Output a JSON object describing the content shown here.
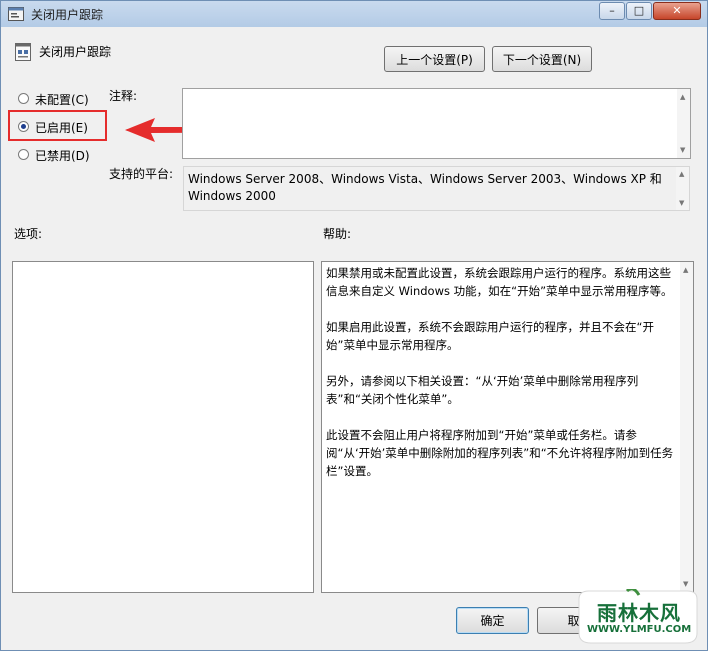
{
  "window": {
    "title": "关闭用户跟踪",
    "controls": {
      "minimize": "–",
      "maximize": "□",
      "close": "✕"
    }
  },
  "header": {
    "policy_name": "关闭用户跟踪",
    "prev_button": "上一个设置(P)",
    "next_button": "下一个设置(N)"
  },
  "options": {
    "not_configured": "未配置(C)",
    "enabled": "已启用(E)",
    "disabled": "已禁用(D)",
    "selected": "enabled"
  },
  "comment": {
    "label": "注释:",
    "value": ""
  },
  "platform": {
    "label": "支持的平台:",
    "value": "Windows Server 2008、Windows Vista、Windows Server 2003、Windows XP 和 Windows 2000"
  },
  "sections": {
    "options_label": "选项:",
    "help_label": "帮助:"
  },
  "help": {
    "paragraphs": [
      "如果禁用或未配置此设置，系统会跟踪用户运行的程序。系统用这些信息来自定义 Windows 功能，如在“开始”菜单中显示常用程序等。",
      "如果启用此设置，系统不会跟踪用户运行的程序，并且不会在“开始”菜单中显示常用程序。",
      "另外，请参阅以下相关设置：“从‘开始’菜单中删除常用程序列表”和“关闭个性化菜单”。",
      "此设置不会阻止用户将程序附加到“开始”菜单或任务栏。请参阅“从‘开始’菜单中删除附加的程序列表”和“不允许将程序附加到任务栏”设置。"
    ]
  },
  "footer": {
    "ok": "确定",
    "cancel": "取"
  },
  "watermark": {
    "name": "雨林木风",
    "url": "WWW.YLMFU.COM"
  },
  "colors": {
    "annotation": "#e52c2c",
    "radio_dot": "#1f3f8f",
    "titlebar": "#b9cfe8"
  }
}
